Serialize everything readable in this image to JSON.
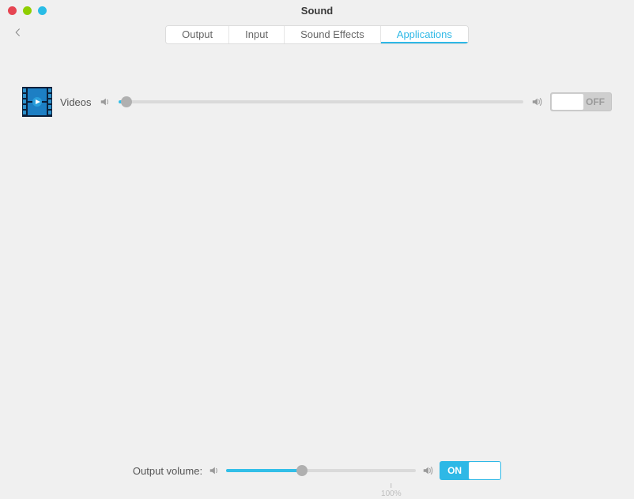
{
  "window": {
    "title": "Sound"
  },
  "tabs": {
    "output": "Output",
    "input": "Input",
    "effects": "Sound Effects",
    "applications": "Applications",
    "active": "applications"
  },
  "apps": [
    {
      "name": "Videos",
      "volume_percent": 2,
      "toggle": "OFF"
    }
  ],
  "output": {
    "label": "Output volume:",
    "volume_percent": 40,
    "scale_label": "100%",
    "toggle": "ON"
  }
}
